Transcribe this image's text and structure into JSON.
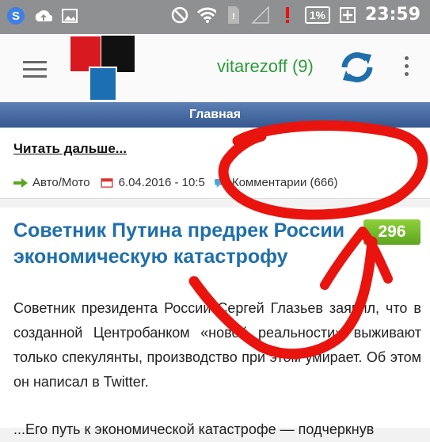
{
  "status": {
    "time": "23:59",
    "battery": "1%"
  },
  "appbar": {
    "username": "vitarezoff (9)"
  },
  "tabbar": {
    "label": "Главная"
  },
  "card1": {
    "read_more": "Читать дальше...",
    "category": "Авто/Мото",
    "date": "6.04.2016 - 10:5",
    "comments": "Комментарии (666)"
  },
  "card2": {
    "headline": "Советник Путина предрек России экономическую катастрофу",
    "score": "296",
    "body": "Советник президента России Сергей Глазьев заявил, что в созданной Центробанком «новой реальности» выживают только спекулянты, производство при этом умирает. Об этом он написал в Twitter.",
    "body_cut": "...Его путь к экономической катастрофе — подчеркнув"
  },
  "colors": {
    "accent_green": "#2d9b3a",
    "header_blue": "#35588f",
    "headline_blue": "#1f6fab",
    "score_green": "#6fb829",
    "annotation_red": "#e8140d"
  }
}
